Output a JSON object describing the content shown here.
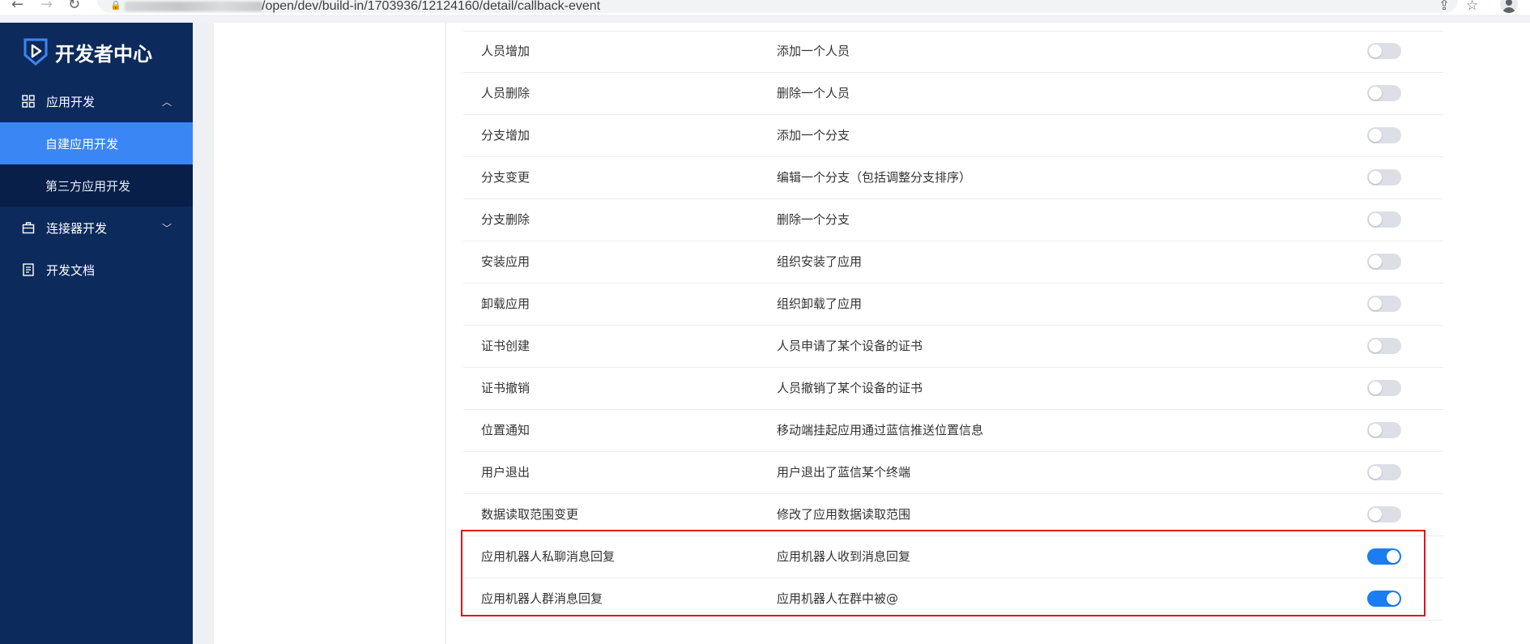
{
  "browser": {
    "url_path": "/open/dev/build-in/1703936/12124160/detail/callback-event"
  },
  "sidebar": {
    "brand_title": "开发者中心",
    "menu": [
      {
        "label": "应用开发",
        "icon": "grid-icon",
        "expanded": true,
        "children": [
          {
            "label": "自建应用开发",
            "active": true
          },
          {
            "label": "第三方应用开发",
            "active": false
          }
        ]
      },
      {
        "label": "连接器开发",
        "icon": "briefcase-icon",
        "expanded": false
      },
      {
        "label": "开发文档",
        "icon": "document-icon"
      }
    ]
  },
  "events": [
    {
      "name": "人员增加",
      "desc": "添加一个人员",
      "enabled": false
    },
    {
      "name": "人员删除",
      "desc": "删除一个人员",
      "enabled": false
    },
    {
      "name": "分支增加",
      "desc": "添加一个分支",
      "enabled": false
    },
    {
      "name": "分支变更",
      "desc": "编辑一个分支（包括调整分支排序）",
      "enabled": false
    },
    {
      "name": "分支删除",
      "desc": "删除一个分支",
      "enabled": false
    },
    {
      "name": "安装应用",
      "desc": "组织安装了应用",
      "enabled": false
    },
    {
      "name": "卸载应用",
      "desc": "组织卸载了应用",
      "enabled": false
    },
    {
      "name": "证书创建",
      "desc": "人员申请了某个设备的证书",
      "enabled": false
    },
    {
      "name": "证书撤销",
      "desc": "人员撤销了某个设备的证书",
      "enabled": false
    },
    {
      "name": "位置通知",
      "desc": "移动端挂起应用通过蓝信推送位置信息",
      "enabled": false
    },
    {
      "name": "用户退出",
      "desc": "用户退出了蓝信某个终端",
      "enabled": false
    },
    {
      "name": "数据读取范围变更",
      "desc": "修改了应用数据读取范围",
      "enabled": false
    },
    {
      "name": "应用机器人私聊消息回复",
      "desc": "应用机器人收到消息回复",
      "enabled": true
    },
    {
      "name": "应用机器人群消息回复",
      "desc": "应用机器人在群中被@",
      "enabled": true
    }
  ],
  "colors": {
    "sidebar_bg": "#0d2a5c",
    "submenu_bg": "#071f49",
    "active_item": "#3a86f5",
    "toggle_on": "#1a7ef2",
    "toggle_off": "#dcdfe6",
    "highlight_border": "#e8101b"
  }
}
